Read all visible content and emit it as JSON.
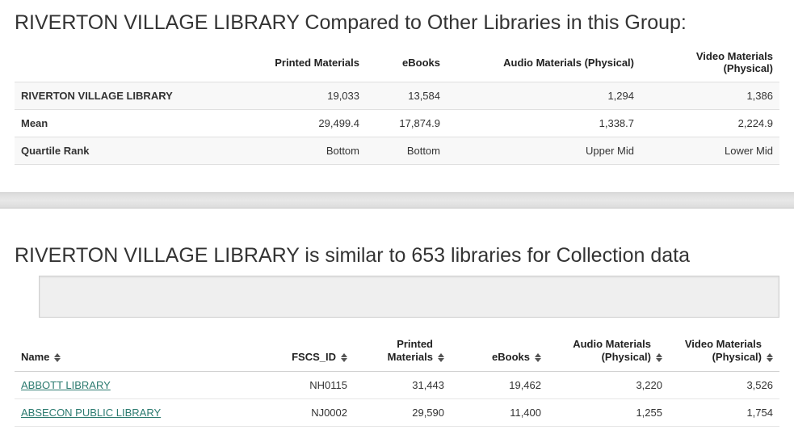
{
  "comparison": {
    "heading": "RIVERTON VILLAGE LIBRARY Compared to Other Libraries in this Group:",
    "columns": [
      "Printed Materials",
      "eBooks",
      "Audio Materials (Physical)",
      "Video Materials (Physical)"
    ],
    "rows": [
      {
        "label": "RIVERTON VILLAGE LIBRARY",
        "values": [
          "19,033",
          "13,584",
          "1,294",
          "1,386"
        ]
      },
      {
        "label": "Mean",
        "values": [
          "29,499.4",
          "17,874.9",
          "1,338.7",
          "2,224.9"
        ]
      },
      {
        "label": "Quartile Rank",
        "values": [
          "Bottom",
          "Bottom",
          "Upper Mid",
          "Lower Mid"
        ]
      }
    ]
  },
  "similar": {
    "heading": "RIVERTON VILLAGE LIBRARY is similar to 653 libraries for Collection data",
    "columns": [
      "Name",
      "FSCS_ID",
      "Printed Materials",
      "eBooks",
      "Audio Materials (Physical)",
      "Video Materials (Physical)"
    ],
    "rows": [
      {
        "name": "ABBOTT LIBRARY",
        "fscs": "NH0115",
        "printed": "31,443",
        "ebooks": "19,462",
        "audio": "3,220",
        "video": "3,526"
      },
      {
        "name": "ABSECON PUBLIC LIBRARY",
        "fscs": "NJ0002",
        "printed": "29,590",
        "ebooks": "11,400",
        "audio": "1,255",
        "video": "1,754"
      }
    ]
  }
}
